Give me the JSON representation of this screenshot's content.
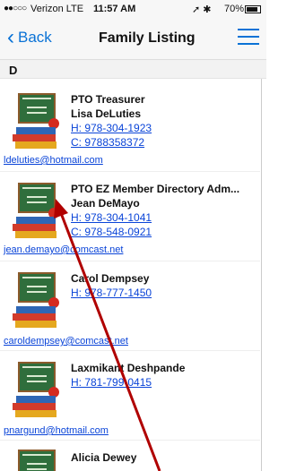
{
  "status_bar": {
    "signal": "●●○○○",
    "carrier": "Verizon  LTE",
    "time": "11:57 AM",
    "icons": "➚ ✱",
    "battery": "70%"
  },
  "nav": {
    "back_label": "Back",
    "title": "Family Listing"
  },
  "section": {
    "letter": "D"
  },
  "entries": [
    {
      "title": "PTO Treasurer",
      "name": "Lisa  DeLuties",
      "phone_home": "H: 978-304-1923",
      "phone_cell": "C: 9788358372",
      "email": "ldeluties@hotmail.com"
    },
    {
      "title": "PTO EZ Member Directory Adm...",
      "name": "Jean  DeMayo",
      "phone_home": "H: 978-304-1041",
      "phone_cell": "C: 978-548-0921",
      "email": "jean.demayo@comcast.net"
    },
    {
      "name": "Carol  Dempsey",
      "phone_home": "H: 978-777-1450",
      "email": "caroldempsey@comcast.net"
    },
    {
      "name": "Laxmikant  Deshpande",
      "phone_home": "H: 781-799-0415",
      "email": "pnargund@hotmail.com"
    },
    {
      "name": "Alicia  Dewey"
    }
  ],
  "colors": {
    "accent": "#0a72d6",
    "link": "#0a44d8",
    "annotation_arrow": "#b00000"
  },
  "icons": {
    "back": "chevron-left-icon",
    "menu": "hamburger-menu-icon",
    "thumbnail": "school-directory-logo"
  }
}
